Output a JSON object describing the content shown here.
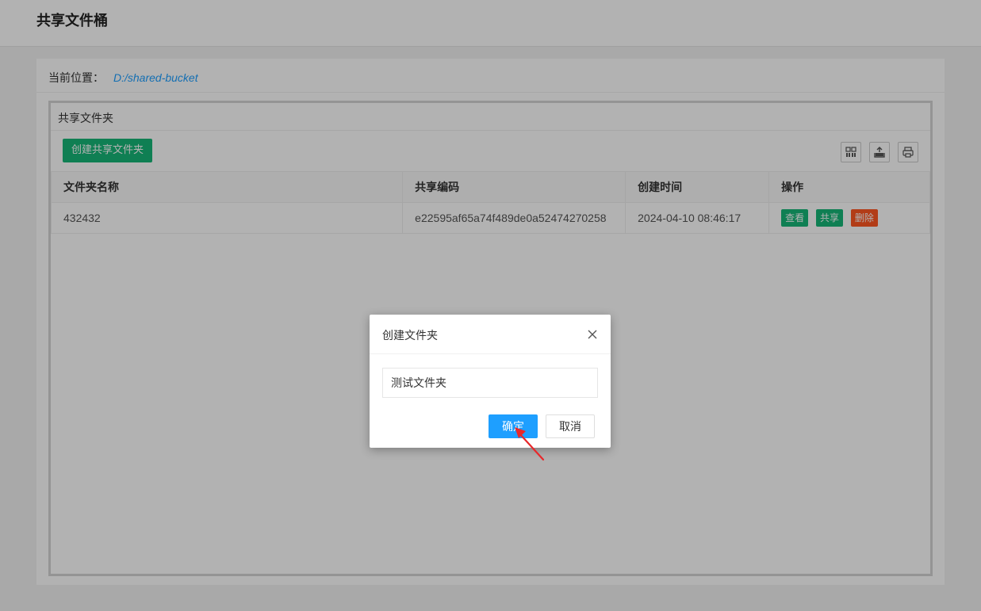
{
  "header": {
    "title": "共享文件桶"
  },
  "location": {
    "label": "当前位置：",
    "path": "D:/shared-bucket"
  },
  "panel": {
    "title": "共享文件夹",
    "create_button": "创建共享文件夹",
    "tool_icons": [
      "columns-icon",
      "export-icon",
      "print-icon"
    ],
    "table": {
      "columns": [
        "文件夹名称",
        "共享编码",
        "创建时间",
        "操作"
      ],
      "rows": [
        {
          "name": "432432",
          "code": "e22595af65a74f489de0a52474270258",
          "created": "2024-04-10 08:46:17",
          "actions": [
            "查看",
            "共享",
            "删除"
          ]
        }
      ]
    }
  },
  "dialog": {
    "title": "创建文件夹",
    "input_value": "测试文件夹",
    "ok_label": "确定",
    "cancel_label": "取消"
  },
  "colors": {
    "green": "#16b777",
    "blue": "#1e9fff",
    "red": "#ff5722",
    "arrow": "#e8282b"
  }
}
